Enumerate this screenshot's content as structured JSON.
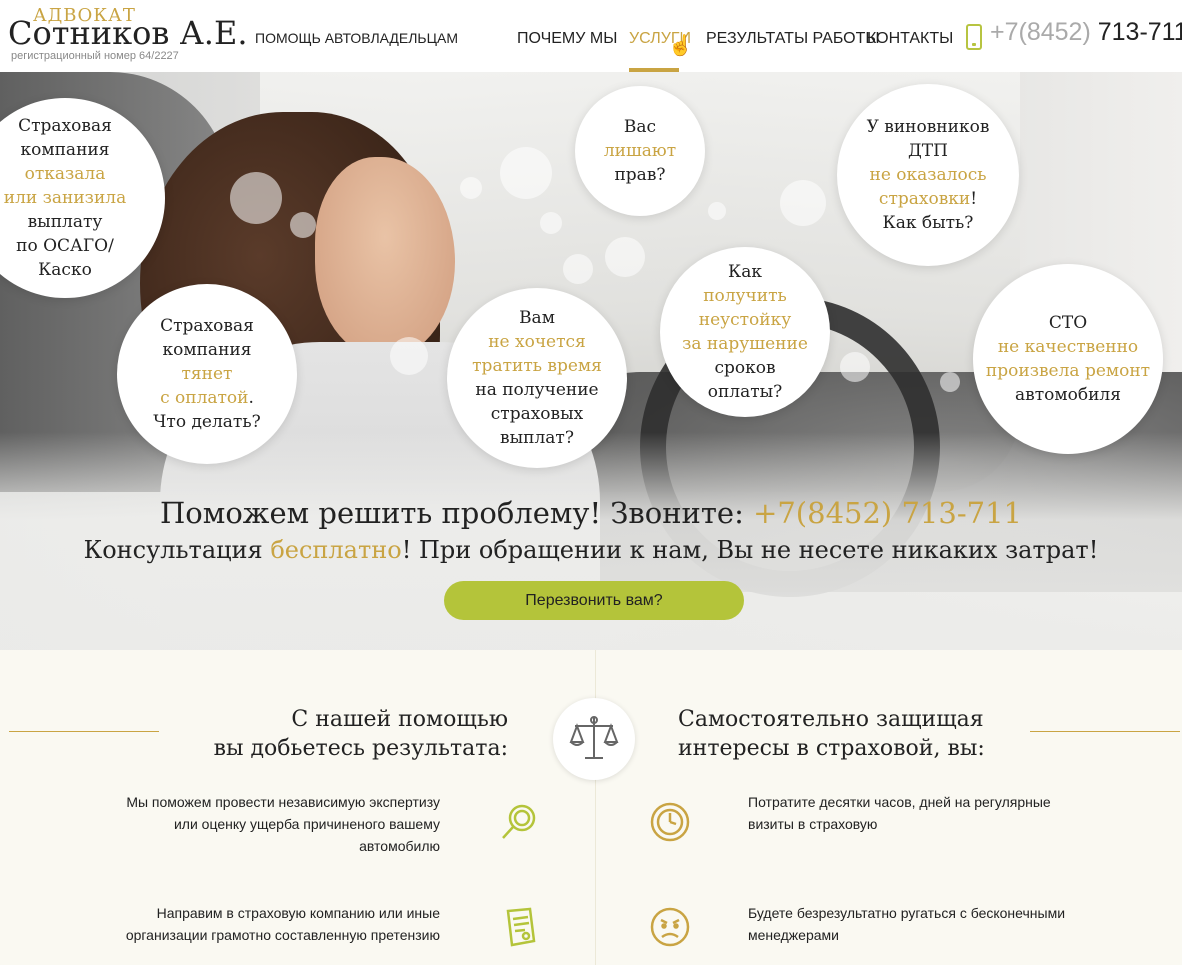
{
  "header": {
    "logo_top": "АДВОКАТ",
    "logo_name": "Сотников А.Е.",
    "logo_reg": "регистрационный номер 64/2227",
    "nav": [
      "ПОМОЩЬ АВТОВЛАДЕЛЬЦАМ",
      "ПОЧЕМУ МЫ",
      "УСЛУГИ",
      "РЕЗУЛЬТАТЫ РАБОТЫ",
      "КОНТАКТЫ"
    ],
    "phone_prefix": "+7(8452)",
    "phone_number": "713-711",
    "accent": "#c9a443"
  },
  "hero": {
    "bubbles": {
      "b1": {
        "l1": "Страховая",
        "l2": "компания",
        "l3": "отказала",
        "l4": "или занизила",
        "l5": "выплату",
        "l6": "по ОСАГО/",
        "l7": "Каско"
      },
      "b2": {
        "l1": "Страховая",
        "l2": "компания",
        "l3": "тянет",
        "l4": "с оплатой",
        "l4b": ".",
        "l5": "Что делать?"
      },
      "b3": {
        "l1": "Вам",
        "l2": "не хочется",
        "l3": "тратить время",
        "l4": "на получение",
        "l5": "страховых",
        "l6": "выплат?"
      },
      "b4": {
        "l1": "Вас",
        "l2": "лишают",
        "l3": "прав?"
      },
      "b5": {
        "l1": "Как",
        "l2": "получить",
        "l3": "неустойку",
        "l4": "за нарушение",
        "l5": "сроков",
        "l6": "оплаты?"
      },
      "b6": {
        "l1": "У виновников",
        "l2": "ДТП",
        "l3": "не оказалось",
        "l4": "страховки",
        "l4b": "!",
        "l5": "Как быть?"
      },
      "b7": {
        "l1": "СТО",
        "l2": "не качественно",
        "l3": "произвела ремонт",
        "l4": "автомобиля"
      }
    },
    "title_text": "Поможем решить проблему! Звоните: ",
    "title_phone": "+7(8452) 713-711",
    "sub_a": "Консультация ",
    "sub_b": "бесплатно",
    "sub_c": "! При обращении к нам, Вы не несете никаких затрат!",
    "cta_label": "Перезвонить вам?",
    "cta_color": "#b4c43a"
  },
  "lower": {
    "left_title_1": "С нашей помощью",
    "left_title_2": "вы добьетесь результата:",
    "right_title_1": "Самостоятельно защищая",
    "right_title_2": "интересы в страховой, вы:",
    "left_items": [
      {
        "l1": "Мы поможем провести независимую экспертизу",
        "l2": "или оценку ущерба причиненого вашему",
        "l3": "автомобилю",
        "icon": "magnifier-icon"
      },
      {
        "l1": "Направим в страховую компанию или иные",
        "l2": "организации грамотно составленную претензию",
        "icon": "document-icon"
      }
    ],
    "right_items": [
      {
        "l1": "Потратите десятки часов, дней на регулярные",
        "l2": "визиты в страховую",
        "icon": "clock-icon"
      },
      {
        "l1": "Будете безрезультатно ругаться с бесконечными",
        "l2": "менеджерами",
        "icon": "angry-face-icon"
      }
    ]
  }
}
